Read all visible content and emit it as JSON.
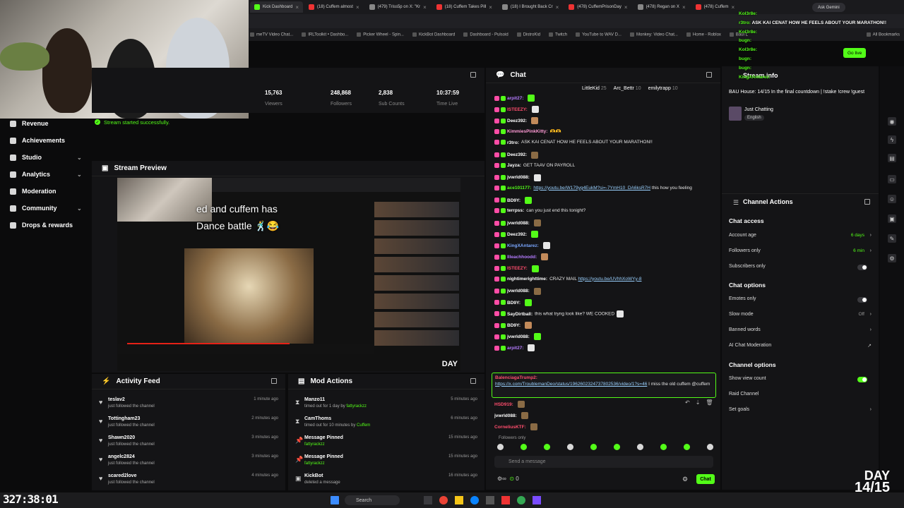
{
  "browser": {
    "tabs": [
      {
        "label": "Kick Dashboard",
        "active": true
      },
      {
        "label": "(18) Cuffem almost"
      },
      {
        "label": "(479) Triss5p on X: \"Kr"
      },
      {
        "label": "(18) Cuffem Takes Pill"
      },
      {
        "label": "(18) I Brought Back Cr"
      },
      {
        "label": "(478) CuffemPrisonDay"
      },
      {
        "label": "(478) Regan on X"
      },
      {
        "label": "(478) Cuffem"
      }
    ],
    "ask_gemini": "Ask Gemini",
    "bookmarks": [
      "meTV Video Chat...",
      "IRLToolkit • Dashbo...",
      "Picker Wheel - Spin...",
      "KickBot Dashboard",
      "Dashboard - Pulsoid",
      "DistroKid",
      "Twitch",
      "YouTube to WAV D...",
      "Monkey: Video Chat...",
      "Home - Roblox",
      "Baui L"
    ],
    "all_bookmarks": "All Bookmarks"
  },
  "sidebar": {
    "items": [
      {
        "label": "Revenue",
        "icon": "dollar-icon"
      },
      {
        "label": "Achievements",
        "icon": "trophy-icon"
      },
      {
        "label": "Studio",
        "icon": "studio-icon",
        "chevron": true
      },
      {
        "label": "Analytics",
        "icon": "chart-icon",
        "chevron": true
      },
      {
        "label": "Moderation",
        "icon": "wrench-icon"
      },
      {
        "label": "Community",
        "icon": "users-icon",
        "chevron": true
      },
      {
        "label": "Drops & rewards",
        "icon": "gift-icon"
      }
    ]
  },
  "stats": [
    {
      "value": "15,763",
      "label": "Viewers"
    },
    {
      "value": "248,868",
      "label": "Followers"
    },
    {
      "value": "2,838",
      "label": "Sub Counts"
    },
    {
      "value": "10:37:59",
      "label": "Time Live"
    }
  ],
  "toast": "Stream started successfully.",
  "preview": {
    "title": "Stream Preview",
    "caption_line1": "ed and cuffem has",
    "caption_line2": "Dance battle 🕺😂",
    "day": "DAY"
  },
  "activity": {
    "title": "Activity Feed",
    "items": [
      {
        "name": "teslav2",
        "text": "just followed the channel",
        "time": "1 minute ago"
      },
      {
        "name": "Tottingham23",
        "text": "just followed the channel",
        "time": "2 minutes ago"
      },
      {
        "name": "Shawn2020",
        "text": "just followed the channel",
        "time": "3 minutes ago"
      },
      {
        "name": "angelc2824",
        "text": "just followed the channel",
        "time": "3 minutes ago"
      },
      {
        "name": "scared2love",
        "text": "just followed the channel",
        "time": "4 minutes ago"
      }
    ]
  },
  "mod_actions": {
    "title": "Mod Actions",
    "items": [
      {
        "name": "Manzo11",
        "text": "timed out for 1 day by",
        "by": "fattyrackzz",
        "time": "5 minutes ago",
        "icon": "hourglass-icon"
      },
      {
        "name": "CamThoms",
        "text": "timed out for 10 minutes by",
        "by": "Cuffem",
        "time": "6 minutes ago",
        "icon": "hourglass-icon"
      },
      {
        "name": "Message Pinned",
        "text": "",
        "by": "fattyrackzz",
        "time": "15 minutes ago",
        "icon": "pin-icon"
      },
      {
        "name": "Message Pinned",
        "text": "",
        "by": "fattyrackzz",
        "time": "15 minutes ago",
        "icon": "pin-icon"
      },
      {
        "name": "KickBot",
        "text": "deleted a message",
        "by": "",
        "time": "16 minutes ago",
        "icon": "bot-icon"
      }
    ]
  },
  "chat": {
    "title": "Chat",
    "top_gifters": [
      {
        "name": "LittleKid",
        "count": "25"
      },
      {
        "name": "Arc_Bettr",
        "count": "10"
      },
      {
        "name": "emilytrapp",
        "count": "10"
      }
    ],
    "messages": [
      {
        "user": "arpit27:",
        "text": "",
        "color": "#b57cff",
        "url": false
      },
      {
        "user": "ISTEEZY:",
        "text": "",
        "color": "#ff4d6d",
        "url": false
      },
      {
        "user": "Deez392:",
        "text": "",
        "color": "#ffffff",
        "url": false
      },
      {
        "user": "KimmiesPinkKitty:",
        "text": "🫶🫶",
        "color": "#ff9ad5",
        "url": false
      },
      {
        "user": "r3tro:",
        "text": "ASK KAI CENAT HOW HE FEELS ABOUT YOUR MARATHON!!",
        "color": "#ffffff",
        "url": false
      },
      {
        "user": "Deez392:",
        "text": "",
        "color": "#ffffff",
        "url": false
      },
      {
        "user": "Jayza:",
        "text": "GET TAAV ON PAYROLL",
        "color": "#ffffff",
        "url": false
      },
      {
        "user": "jvwrld088:",
        "text": "",
        "color": "#ffffff",
        "url": false
      },
      {
        "user": "ace101177:",
        "text": "https://youtu.be/W179yg4EukM?si=-7YmH10_DA6ksR7H",
        "suffix": "this how you feeling",
        "color": "#53fc18",
        "url": true
      },
      {
        "user": "BD9Y:",
        "text": "",
        "color": "#ffffff",
        "url": false
      },
      {
        "user": "terrpss:",
        "text": "can you just end this tonight?",
        "color": "#ffffff",
        "url": false
      },
      {
        "user": "jvwrld088:",
        "text": "",
        "color": "#ffffff",
        "url": false
      },
      {
        "user": "Deez392:",
        "text": "",
        "color": "#ffffff",
        "url": false
      },
      {
        "user": "KingXAntarez:",
        "text": "",
        "color": "#7aa7ff",
        "url": false
      },
      {
        "user": "Illeachhoodd:",
        "text": "",
        "color": "#b57cff",
        "url": false
      },
      {
        "user": "ISTEEZY:",
        "text": "",
        "color": "#ff4d6d",
        "url": false
      },
      {
        "user": "nightimerighttime:",
        "text": "CRAZY MAIL",
        "suffix_url": "https://youtu.be/UVhhXoWYy-8",
        "color": "#ffffff",
        "url": false
      },
      {
        "user": "jvwrld088:",
        "text": "",
        "color": "#ffffff",
        "url": false
      },
      {
        "user": "BD9Y:",
        "text": "",
        "color": "#ffffff",
        "url": false
      },
      {
        "user": "SayDirtball:",
        "text": "this what tryng look like? WE COOKED",
        "color": "#ffffff",
        "url": false
      },
      {
        "user": "BD9Y:",
        "text": "",
        "color": "#ffffff",
        "url": false
      },
      {
        "user": "jvwrld088:",
        "text": "",
        "color": "#ffffff",
        "url": false
      },
      {
        "user": "arpit27:",
        "text": "",
        "color": "#b57cff",
        "url": false
      }
    ],
    "highlight": {
      "user": "BalenciagaTrump2:",
      "url": "https://x.com/TroublemanDeo/status/1962602324737802536/video/1?s=46",
      "text": "I miss the old cuffem @cuffem"
    },
    "after": [
      {
        "user": "HSD919:",
        "color": "#ff4d6d"
      },
      {
        "user": "jvwrld088:",
        "color": "#ffffff"
      },
      {
        "user": "CorneliusKTF:",
        "color": "#ff4d6d"
      }
    ],
    "followers_only": "Followers only",
    "input_placeholder": "Send a message",
    "points": "0",
    "chat_button": "Chat"
  },
  "stream_info": {
    "title": "Stream info",
    "description": "BAU House: 14/15 In the final countdown | !stake !crew !guest",
    "category": "Just Chatting",
    "language": "English"
  },
  "overlay_chat": [
    {
      "user": "Kol3r8e:"
    },
    {
      "user": "r3tro:",
      "text": "ASK KAI CENAT HOW HE FEELS ABOUT YOUR MARATHON!!"
    },
    {
      "user": "Kol3r8e:"
    },
    {
      "user": "bugn:"
    },
    {
      "user": "Kol3r8e:"
    },
    {
      "user": "bugn:"
    },
    {
      "user": "bugn:"
    },
    {
      "user": "KingXAntarez:"
    }
  ],
  "go_live": "Go live",
  "channel_actions": {
    "title": "Channel Actions",
    "chat_access": "Chat access",
    "account_age": {
      "label": "Account age",
      "value": "6 days"
    },
    "followers_only": {
      "label": "Followers only",
      "value": "6 min"
    },
    "subscribers_only": {
      "label": "Subscribers only",
      "on": false
    },
    "chat_options": "Chat options",
    "emotes_only": {
      "label": "Emotes only",
      "on": false
    },
    "slow_mode": {
      "label": "Slow mode",
      "value": "Off"
    },
    "banned_words": "Banned words",
    "ai_moderation": "AI Chat Moderation",
    "channel_options": "Channel options",
    "show_view_count": {
      "label": "Show view count",
      "on": true
    },
    "raid_channel": "Raid Channel",
    "set_goals": "Set goals"
  },
  "taskbar": {
    "search": "Search"
  },
  "stream_timer": "327:38:01",
  "day_overlay": {
    "line1": "DAY",
    "line2": "14/15"
  },
  "colors": {
    "accent": "#53fc18",
    "panel": "#141416",
    "bg": "#0b0b0c"
  }
}
